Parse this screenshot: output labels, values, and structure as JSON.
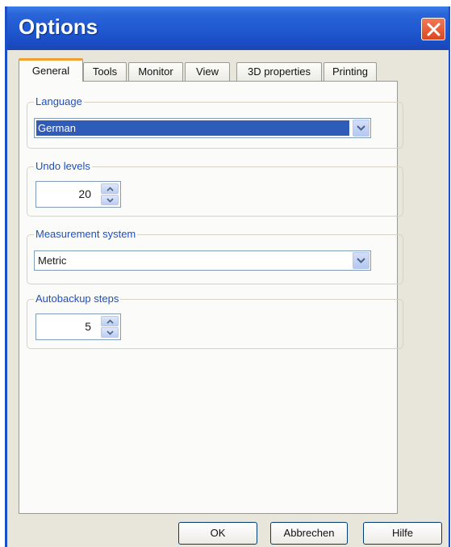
{
  "window": {
    "title": "Options"
  },
  "tabs": [
    {
      "label": "General"
    },
    {
      "label": "Tools"
    },
    {
      "label": "Monitor"
    },
    {
      "label": "View"
    },
    {
      "label": "3D properties"
    },
    {
      "label": "Printing"
    }
  ],
  "active_tab": "General",
  "language": {
    "label": "Language",
    "value": "German"
  },
  "undo_levels": {
    "label": "Undo levels",
    "value": "20"
  },
  "measurement": {
    "label": "Measurement system",
    "value": "Metric"
  },
  "autobackup": {
    "label": "Autobackup steps",
    "value": "5"
  },
  "buttons": {
    "ok": "OK",
    "cancel": "Abbrechen",
    "help": "Hilfe"
  },
  "colors": {
    "titlebar": "#1f58d0",
    "close": "#d94820",
    "selection": "#2f5cb8",
    "group_label": "#1e4fc0",
    "active_tab_accent": "#f0a030"
  }
}
